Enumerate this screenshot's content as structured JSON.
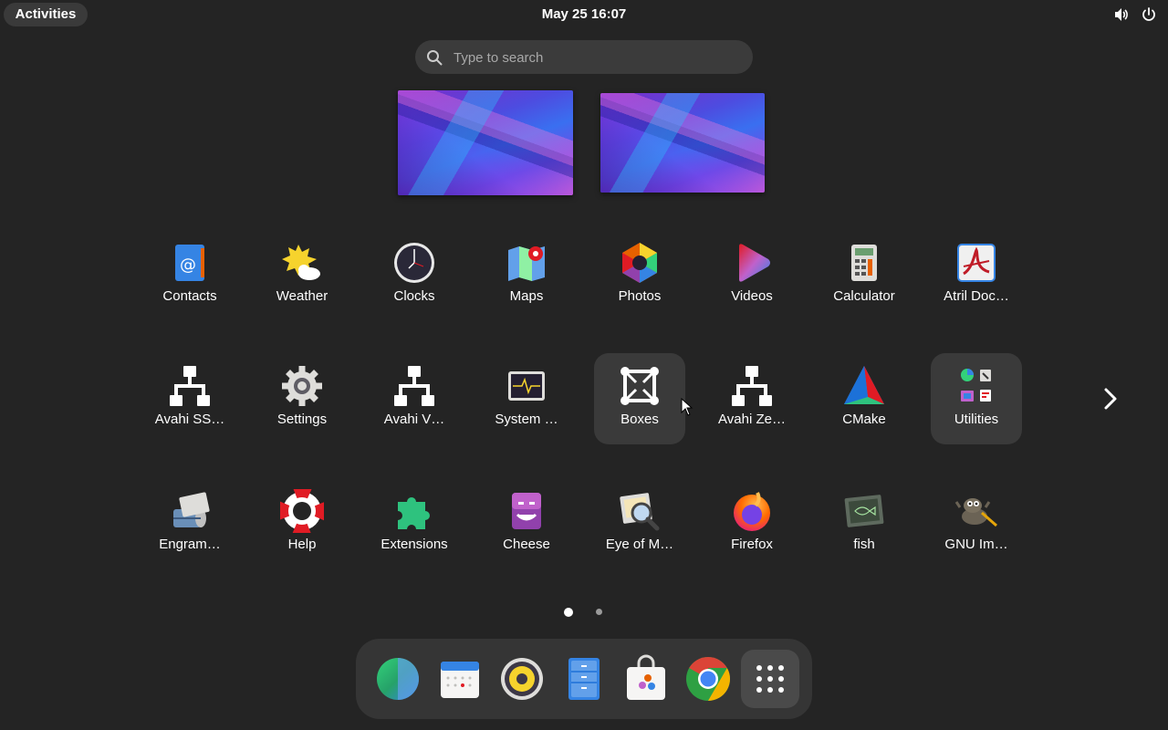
{
  "topbar": {
    "activities": "Activities",
    "clock": "May 25  16:07",
    "icons": [
      "volume-icon",
      "power-icon"
    ]
  },
  "search": {
    "placeholder": "Type to search"
  },
  "workspaces": [
    "workspace-1",
    "workspace-2"
  ],
  "apps": {
    "row1": [
      "Contacts",
      "Weather",
      "Clocks",
      "Maps",
      "Photos",
      "Videos",
      "Calculator",
      "Atril Doc…"
    ],
    "row2": [
      "Avahi SS…",
      "Settings",
      "Avahi V…",
      "System …",
      "Boxes",
      "Avahi Ze…",
      "CMake",
      "Utilities"
    ],
    "row3": [
      "Engram…",
      "Help",
      "Extensions",
      "Cheese",
      "Eye of M…",
      "Firefox",
      "fish",
      "GNU Im…"
    ]
  },
  "pages": {
    "current": 1,
    "total": 2
  },
  "dash": [
    "Web",
    "Calendar",
    "Rhythmbox",
    "Files",
    "Software",
    "Google Chrome",
    "Show Apps"
  ],
  "colors": {
    "background": "#242424",
    "panel": "#353535",
    "highlight": "#3a3a3a"
  }
}
